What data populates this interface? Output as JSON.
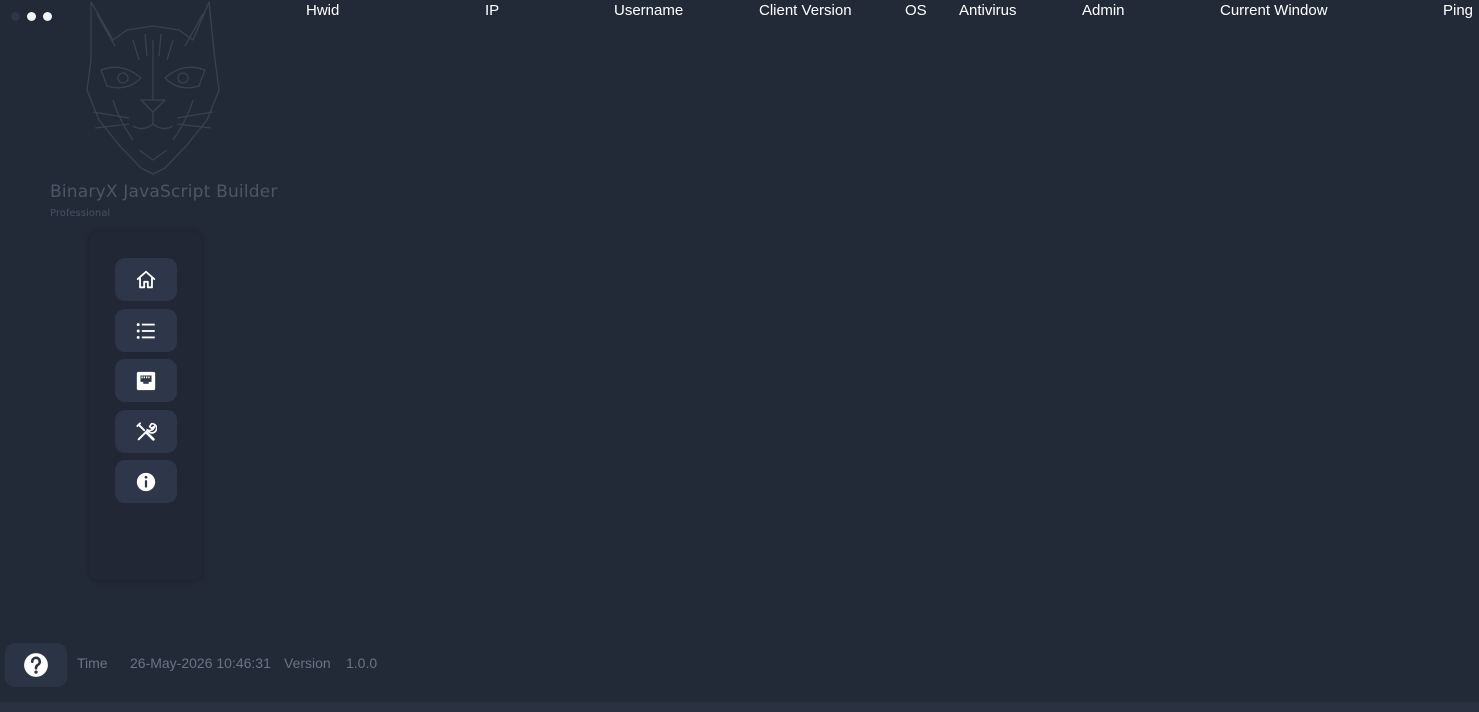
{
  "app": {
    "title": "BinaryX JavaScript Builder",
    "edition": "Professional"
  },
  "table": {
    "columns": [
      "Hwid",
      "IP",
      "Username",
      "Client Version",
      "OS",
      "Antivirus",
      "Admin",
      "Current Window",
      "Ping"
    ],
    "rows": []
  },
  "sidebar": {
    "items": [
      {
        "icon": "home-icon"
      },
      {
        "icon": "list-icon"
      },
      {
        "icon": "network-port-icon"
      },
      {
        "icon": "tools-icon"
      },
      {
        "icon": "info-icon"
      }
    ]
  },
  "status": {
    "time_label": "Time",
    "time_value": "26-May-2026 10:46:31",
    "version_label": "Version",
    "version_value": "1.0.0"
  },
  "colors": {
    "background": "#222937",
    "button": "#2e3749",
    "muted_text": "#6b7384"
  }
}
